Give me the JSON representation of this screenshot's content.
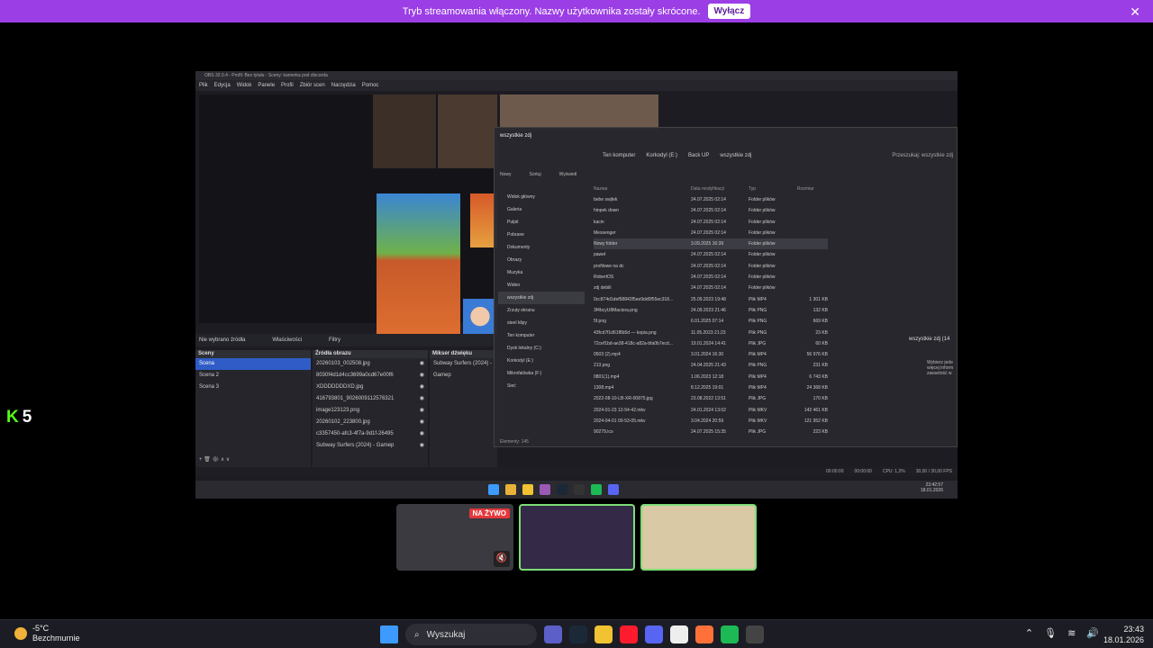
{
  "banner": {
    "text": "Tryb streamowania włączony. Nazwy użytkownika zostały skrócone.",
    "button": "Wyłącz",
    "close": "✕"
  },
  "obs": {
    "title": "OBS 32.0.4 - Profil: Bez tytułu - Sceny: kamerka pod discorda",
    "menu": [
      "Plik",
      "Edycja",
      "Widok",
      "Panele",
      "Profil",
      "Zbiór scen",
      "Narzędzia",
      "Pomoc"
    ],
    "source_bar": {
      "none": "Nie wybrano źródła",
      "properties": "Właściwości",
      "filters": "Filtry"
    },
    "scenes": {
      "title": "Sceny",
      "items": [
        "Scena",
        "Scena 2",
        "Scena 3"
      ]
    },
    "sources": {
      "title": "Źródła obrazu",
      "items": [
        "20260103_002508.jpg",
        "8030f4d1d4cc3699a0cd67e00f6",
        "XDDDDDDDXD.jpg",
        "416793801_9026009112576321",
        "image123123.png",
        "20260102_223800.jpg",
        "c3357450-afc3-4f7a-9d1f-26495",
        "Subway Surfers (2024) - Gamep"
      ]
    },
    "mixer": {
      "title": "Mikser dźwięku",
      "item": "Subway Surfers (2024) - Gamep"
    },
    "status": {
      "time1": "00:00:00",
      "time2": "00:00:00",
      "cpu": "CPU: 1,2%",
      "fps": "30,00 / 30,00 FPS"
    }
  },
  "explorer": {
    "tab": "wszystkie zdj",
    "path": [
      "Ten komputer",
      "Korkodyl (E:)",
      "Back UP",
      "wszystkie zdj"
    ],
    "search": "Przeszukaj: wszystkie zdj",
    "tools": [
      "Nowy",
      "Sortuj",
      "Wyświetl"
    ],
    "nav": [
      "Widok główny",
      "Galeria",
      "Pulpit",
      "Pobrane",
      "Dokumenty",
      "Obrazy",
      "Muzyka",
      "Wideo",
      "wszystkie zdj",
      "Zrzuty ekranu",
      "steel klipy",
      "Ten komputer",
      "Dysk lokalny (C:)",
      "Korkodyl (E:)",
      "Mikrofalówka (F:)",
      "Sieć"
    ],
    "columns": [
      "Nazwa",
      "Data modyfikacji",
      "Typ",
      "Rozmiar"
    ],
    "rows": [
      [
        "bebe swjtek",
        "24.07.2025 02:14",
        "Folder plików",
        ""
      ],
      [
        "hinpek down",
        "24.07.2025 02:14",
        "Folder plików",
        ""
      ],
      [
        "kacin",
        "24.07.2025 02:14",
        "Folder plików",
        ""
      ],
      [
        "Messenger",
        "24.07.2025 02:14",
        "Folder plików",
        ""
      ],
      [
        "Nowy folder",
        "3.09.2025 16:39",
        "Folder plików",
        ""
      ],
      [
        "paweł",
        "24.07.2025 02:14",
        "Folder plików",
        ""
      ],
      [
        "profilowe na dc",
        "24.07.2025 02:14",
        "Folder plików",
        ""
      ],
      [
        "RobertOS",
        "24.07.2025 02:14",
        "Folder plików",
        ""
      ],
      [
        "zdj debili",
        "24.07.2025 02:14",
        "Folder plików",
        ""
      ],
      [
        "0cc874d1def58842f5ee9dd0f55ec318...",
        "25.09.2023 19:48",
        "Plik MP4",
        "1 301 KB"
      ],
      [
        "3f4bcyU8Maciora.png",
        "24.09.2023 21:46",
        "Plik PNG",
        "132 KB"
      ],
      [
        "5f.png",
        "6.01.2025 07:14",
        "Plik PNG",
        "669 KB"
      ],
      [
        "43fcd7f1d61f8b5d — kopia.png",
        "11.05.2023 21:23",
        "Plik PNG",
        "23 KB"
      ],
      [
        "72cef1bd-ae38-418c-a82a-bfa0b7ecd...",
        "19.01.2024 14:41",
        "Plik JPG",
        "60 KB"
      ],
      [
        "0503 (2).mp4",
        "3.01.2024 16:30",
        "Plik MP4",
        "56 976 KB"
      ],
      [
        "213.png",
        "24.04.2025 21:43",
        "Plik PNG",
        "231 KB"
      ],
      [
        "0801(1).mp4",
        "1.06.2023 12:18",
        "Plik MP4",
        "6 743 KB"
      ],
      [
        "1308.mp4",
        "8.12.2025 19:01",
        "Plik MP4",
        "24 368 KB"
      ],
      [
        "2022-08-10-LB-XR-00875.jpg",
        "23.08.2022 13:51",
        "Plik JPG",
        "170 KB"
      ],
      [
        "2024-01-23 12-54-42.mkv",
        "24.01.2024 13:02",
        "Plik MKV",
        "142 461 KB"
      ],
      [
        "2024-04-01 00-53-05.mkv",
        "3.04.2024 20:59",
        "Plik MKV",
        "121 952 KB"
      ],
      [
        "90279.ico",
        "24.07.2025 15:35",
        "Plik JPG",
        "223 KB"
      ]
    ],
    "status": "Elementy: 145",
    "detail_title": "wszystkie zdj (14",
    "detail_text": "Wybierz jede więcej inform zawartość w"
  },
  "inner_clock": {
    "time": "23:42:57",
    "date": "18.01.2026"
  },
  "thumbs": {
    "live": "NA ŻYWO"
  },
  "kick": {
    "letter": "K",
    "count": "5"
  },
  "taskbar": {
    "weather_temp": "-5°C",
    "weather_desc": "Bezchmurnie",
    "search": "Wyszukaj",
    "time": "23:43",
    "date": "18.01.2026"
  },
  "colors": {
    "banner": "#9b3ee6",
    "scene_active": "#2f5cc7",
    "speaking": "#7ddc74",
    "kick": "#53fc18",
    "live": "#e5383b"
  }
}
